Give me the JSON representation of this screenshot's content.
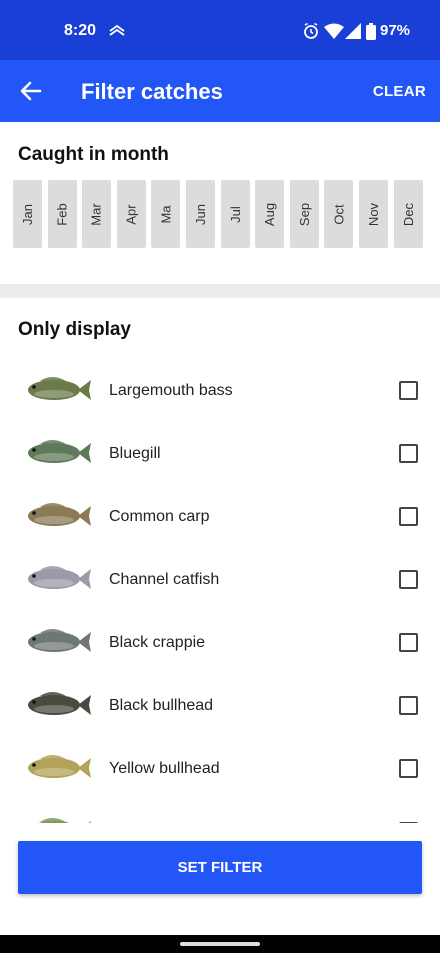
{
  "status_bar": {
    "time": "8:20",
    "battery": "97%",
    "icons": [
      "data-saver-icon",
      "alarm-icon",
      "wifi-icon",
      "signal-icon",
      "battery-icon"
    ]
  },
  "app_bar": {
    "title": "Filter catches",
    "clear_label": "CLEAR",
    "back_icon": "arrow-left-icon"
  },
  "month_section": {
    "title": "Caught in month",
    "months": [
      "Jan",
      "Feb",
      "Mar",
      "Apr",
      "Ma",
      "Jun",
      "Jul",
      "Aug",
      "Sep",
      "Oct",
      "Nov",
      "Dec"
    ]
  },
  "species_section": {
    "title": "Only display",
    "items": [
      {
        "label": "Largemouth bass",
        "checked": false,
        "color": "#6b7a4a"
      },
      {
        "label": "Bluegill",
        "checked": false,
        "color": "#5f7a5a"
      },
      {
        "label": "Common carp",
        "checked": false,
        "color": "#8a7a55"
      },
      {
        "label": "Channel catfish",
        "checked": false,
        "color": "#9a9aa8"
      },
      {
        "label": "Black crappie",
        "checked": false,
        "color": "#6f7772"
      },
      {
        "label": "Black bullhead",
        "checked": false,
        "color": "#4a4a40"
      },
      {
        "label": "Yellow bullhead",
        "checked": false,
        "color": "#b3a35a"
      },
      {
        "label": "",
        "checked": false,
        "color": "#7a9a5a"
      }
    ]
  },
  "set_filter_label": "SET FILTER",
  "colors": {
    "status_bar": "#1a3fd6",
    "app_bar": "#2356f6",
    "button": "#2356f6",
    "month_chip": "#dcdcdc"
  }
}
